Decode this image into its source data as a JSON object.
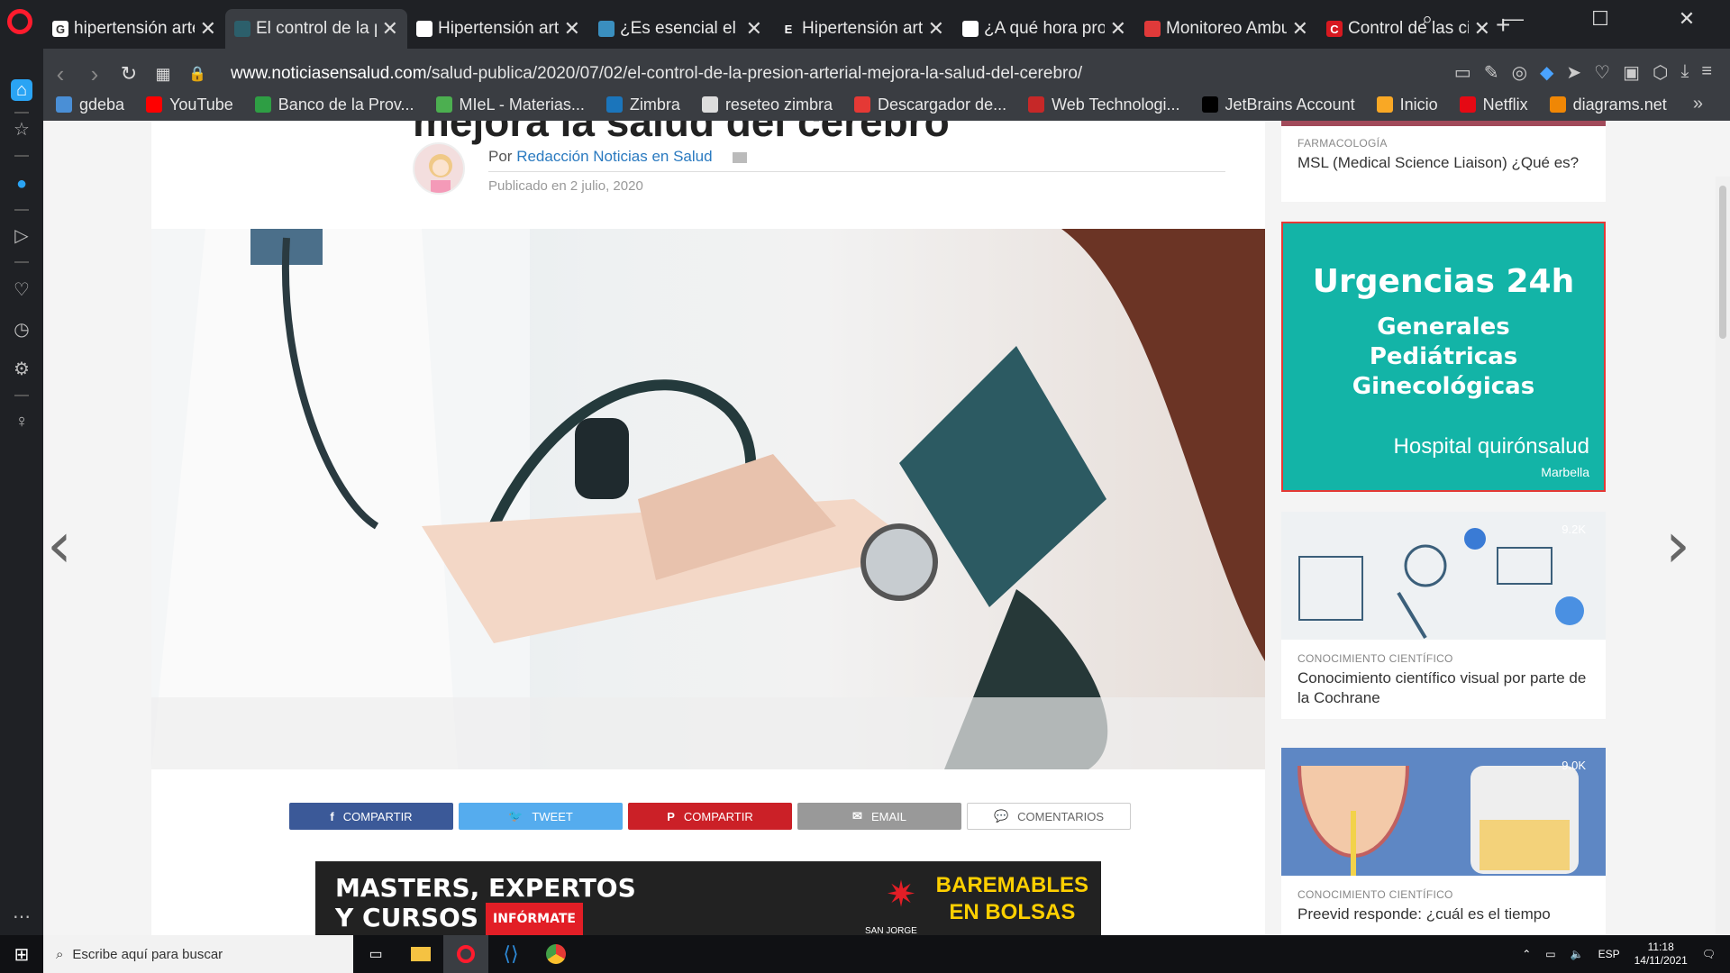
{
  "browser": {
    "tabs": [
      {
        "title": "hipertensión arteri",
        "fav_color": "#ffffff",
        "fav_text": "G",
        "active": false
      },
      {
        "title": "El control de la pre",
        "fav_color": "#2c5f6b",
        "fav_text": "",
        "active": true
      },
      {
        "title": "Hipertensión arter",
        "fav_color": "#ffffff",
        "fav_text": "",
        "active": false
      },
      {
        "title": "¿Es esencial el riñó",
        "fav_color": "#3a8fbf",
        "fav_text": "",
        "active": false
      },
      {
        "title": "Hipertensión arter",
        "fav_color": "#1f2125",
        "fav_text": "E",
        "active": false
      },
      {
        "title": "¿A qué hora propo",
        "fav_color": "#ffffff",
        "fav_text": "",
        "active": false
      },
      {
        "title": "Monitoreo Ambul",
        "fav_color": "#e03a3a",
        "fav_text": "",
        "active": false
      },
      {
        "title": "Control de las cifr",
        "fav_color": "#d71920",
        "fav_text": "C",
        "active": false
      }
    ],
    "url_domain": "www.noticiasensalud.com",
    "url_path": "/salud-publica/2020/07/02/el-control-de-la-presion-arterial-mejora-la-salud-del-cerebro/",
    "bookmarks": [
      {
        "label": "gdeba",
        "color": "#4a8fd6"
      },
      {
        "label": "YouTube",
        "color": "#ff0000"
      },
      {
        "label": "Banco de la Prov...",
        "color": "#2e9e44"
      },
      {
        "label": "MIeL - Materias...",
        "color": "#4caf50"
      },
      {
        "label": "Zimbra",
        "color": "#1b75bb"
      },
      {
        "label": "reseteo zimbra",
        "color": "#dddddd"
      },
      {
        "label": "Descargador de...",
        "color": "#e53935"
      },
      {
        "label": "Web Technologi...",
        "color": "#c62828"
      },
      {
        "label": "JetBrains Account",
        "color": "#000000"
      },
      {
        "label": "Inicio",
        "color": "#f9a825"
      },
      {
        "label": "Netflix",
        "color": "#e50914"
      },
      {
        "label": "diagrams.net",
        "color": "#f08705"
      }
    ]
  },
  "article": {
    "title_fragment": "mejora la salud del cerebro",
    "by_prefix": "Por",
    "author": "Redacción Noticias en Salud",
    "published": "Publicado en 2 julio, 2020",
    "share": [
      {
        "label": "COMPARTIR",
        "icon": "facebook-icon",
        "glyph": "f",
        "color": "#3b5998"
      },
      {
        "label": "TWEET",
        "icon": "twitter-icon",
        "glyph": "🐦",
        "color": "#55acee"
      },
      {
        "label": "COMPARTIR",
        "icon": "pinterest-icon",
        "glyph": "P",
        "color": "#cb2027"
      },
      {
        "label": "EMAIL",
        "icon": "email-icon",
        "glyph": "✉",
        "color": "#999999"
      },
      {
        "label": "COMENTARIOS",
        "icon": "comments-icon",
        "glyph": "💬",
        "color": "#ffffff"
      }
    ],
    "banner_ad": {
      "line1": "MASTERS, EXPERTOS",
      "line2": "Y CURSOS",
      "cta": "INFÓRMATE",
      "university": "SAN JORGE",
      "right_line1": "BAREMABLES",
      "right_line2": "EN BOLSAS"
    }
  },
  "sidebar_right": {
    "top_card": {
      "category": "FARMACOLOGÍA",
      "title": "MSL (Medical Science Liaison) ¿Qué es?"
    },
    "ad": {
      "headline": "Urgencias 24h",
      "lines": [
        "Generales",
        "Pediátricas",
        "Ginecológicas"
      ],
      "brand": "Hospital quirónsalud",
      "place": "Marbella"
    },
    "cards": [
      {
        "category": "CONOCIMIENTO CIENTÍFICO",
        "title": "Conocimiento científico visual por parte de la Cochrane",
        "views": "9.2K"
      },
      {
        "category": "CONOCIMIENTO CIENTÍFICO",
        "title": "Preevid responde: ¿cuál es el tiempo",
        "views": "9.0K"
      }
    ]
  },
  "taskbar": {
    "search_placeholder": "Escribe aquí para buscar",
    "lang": "ESP",
    "time": "11:18",
    "date": "14/11/2021"
  }
}
